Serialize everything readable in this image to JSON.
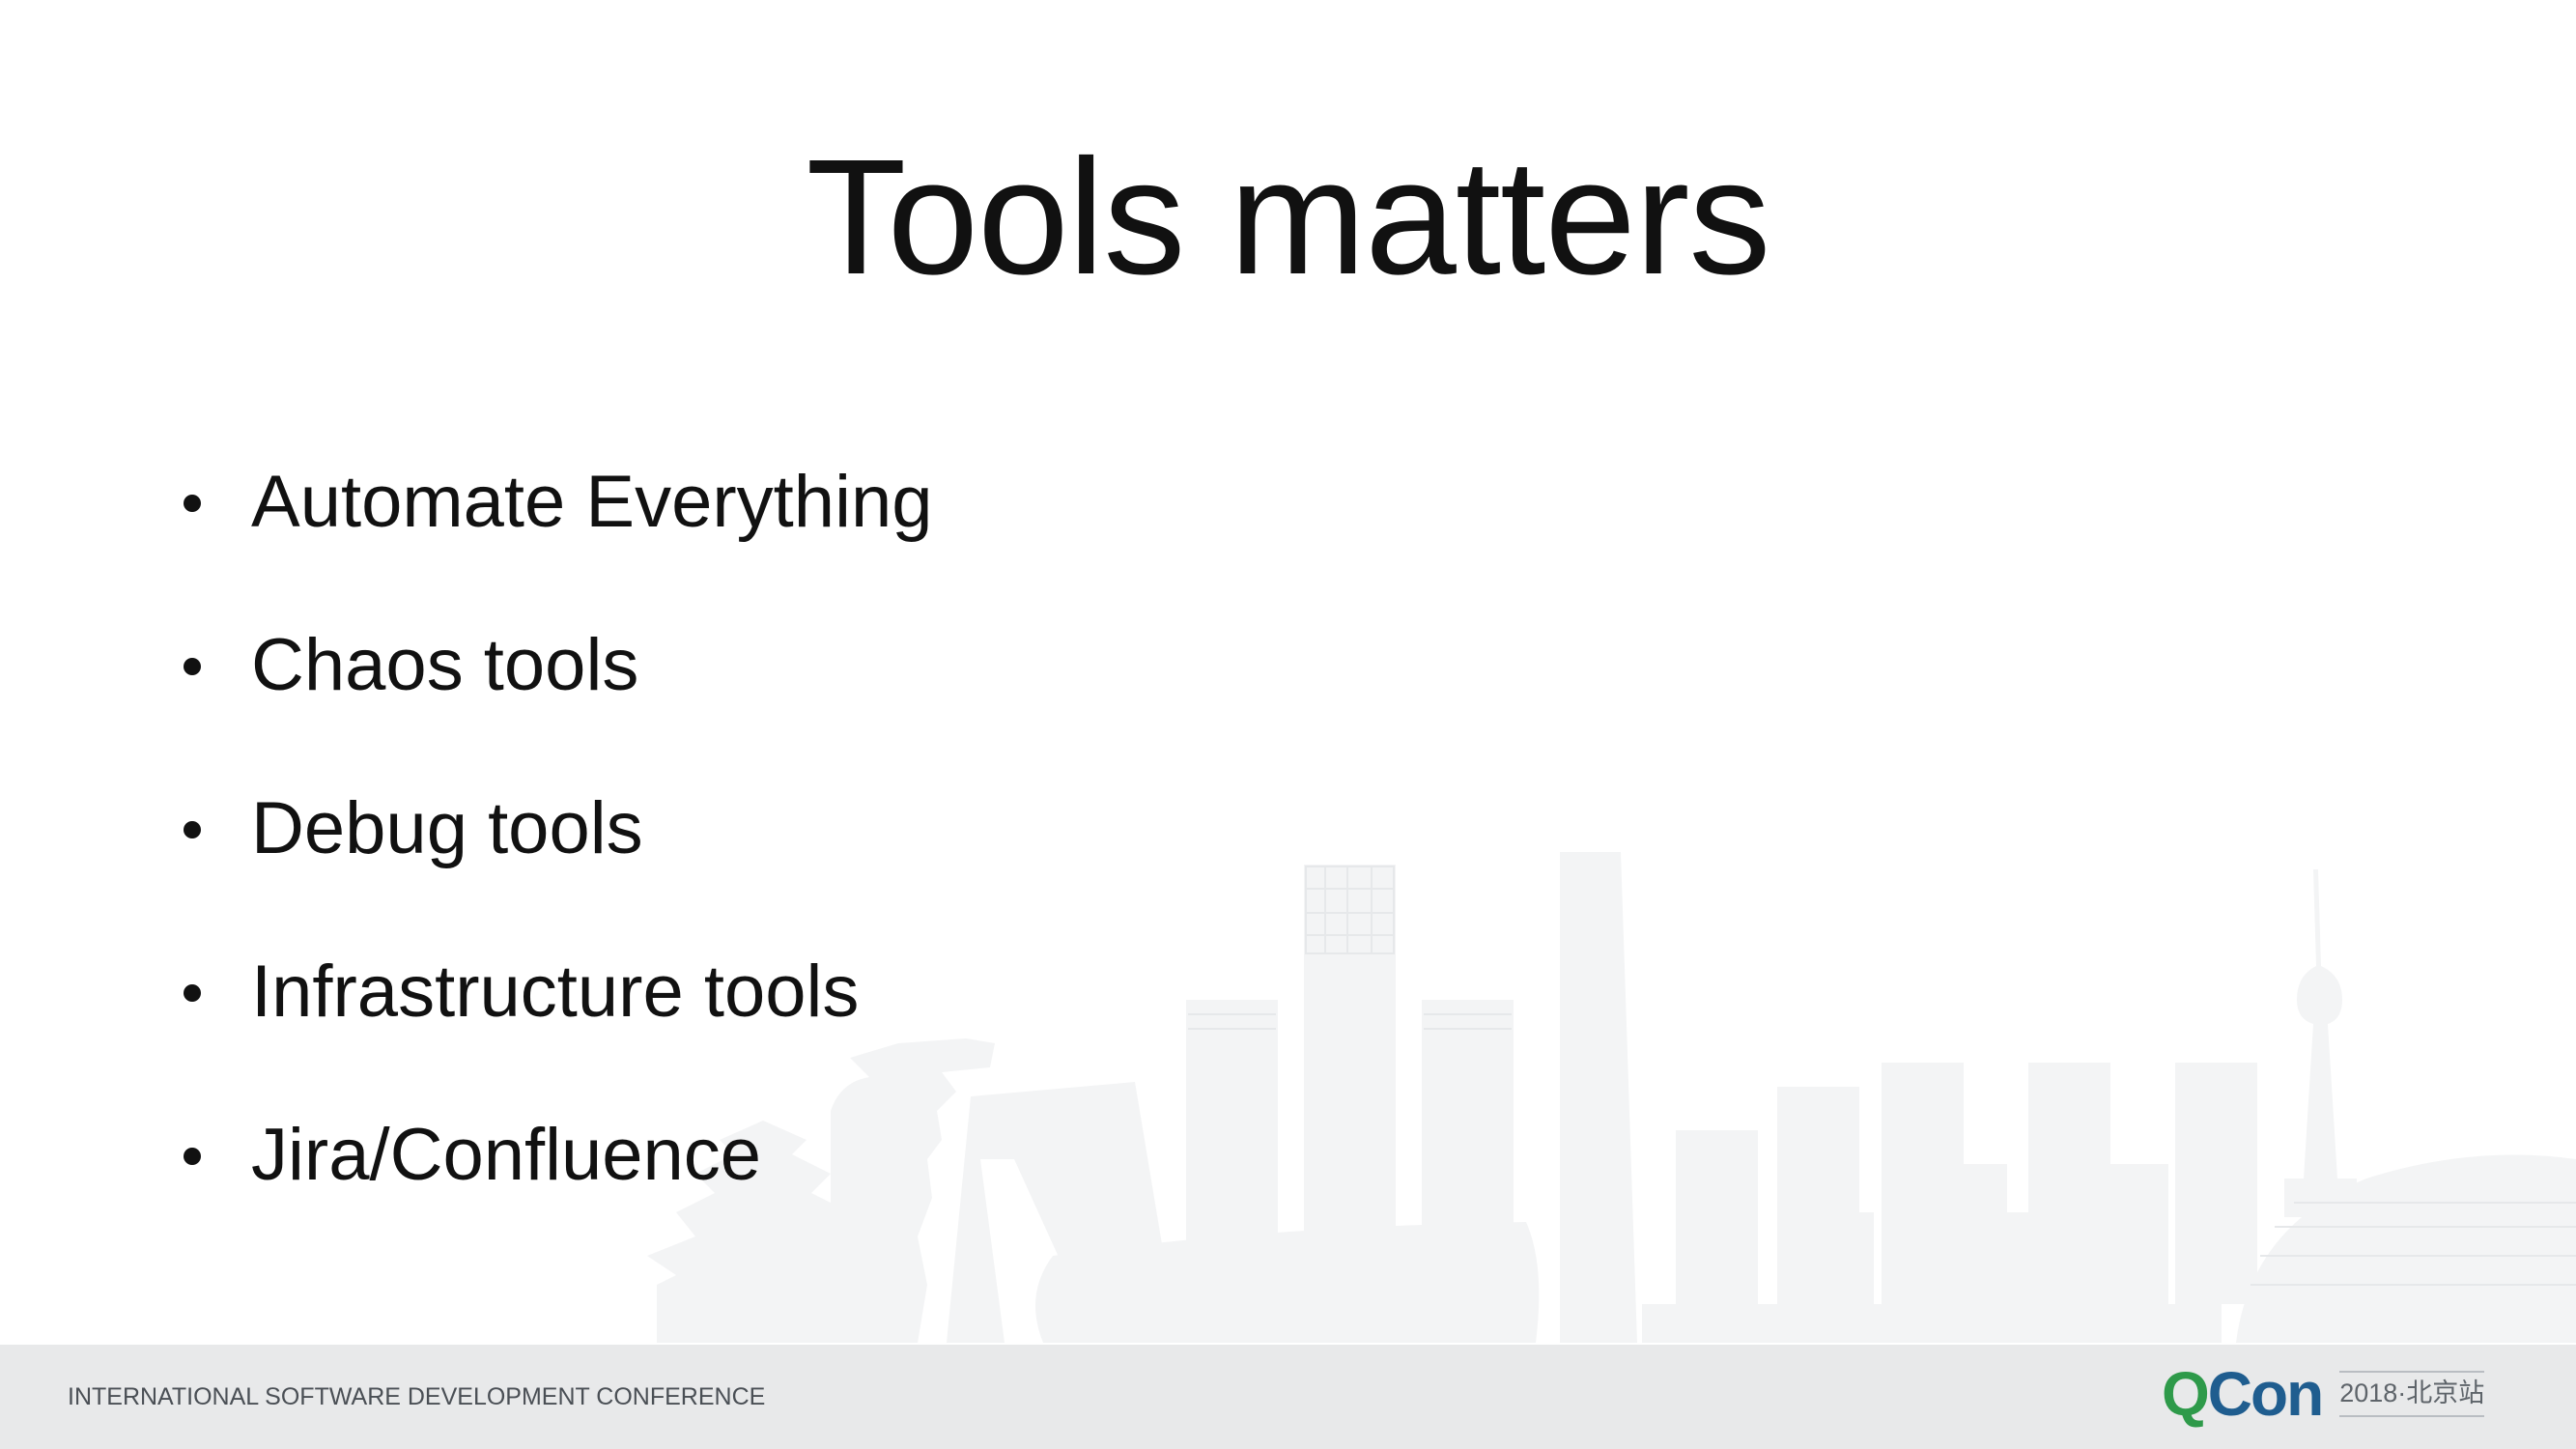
{
  "slide": {
    "title": "Tools matters",
    "bullets": [
      "Automate Everything",
      "Chaos tools",
      "Debug tools",
      "Infrastructure tools",
      "Jira/Confluence"
    ]
  },
  "footer": {
    "conference_name": "INTERNATIONAL SOFTWARE DEVELOPMENT CONFERENCE",
    "logo_q": "Q",
    "logo_con": "Con",
    "logo_edition": "2018·北京站"
  },
  "colors": {
    "text": "#111111",
    "footer_bg": "#e8e9ea",
    "footer_text": "#4a4f55",
    "logo_green": "#2e9a4a",
    "logo_blue": "#1f5d8f",
    "skyline": "#f2f3f4"
  }
}
